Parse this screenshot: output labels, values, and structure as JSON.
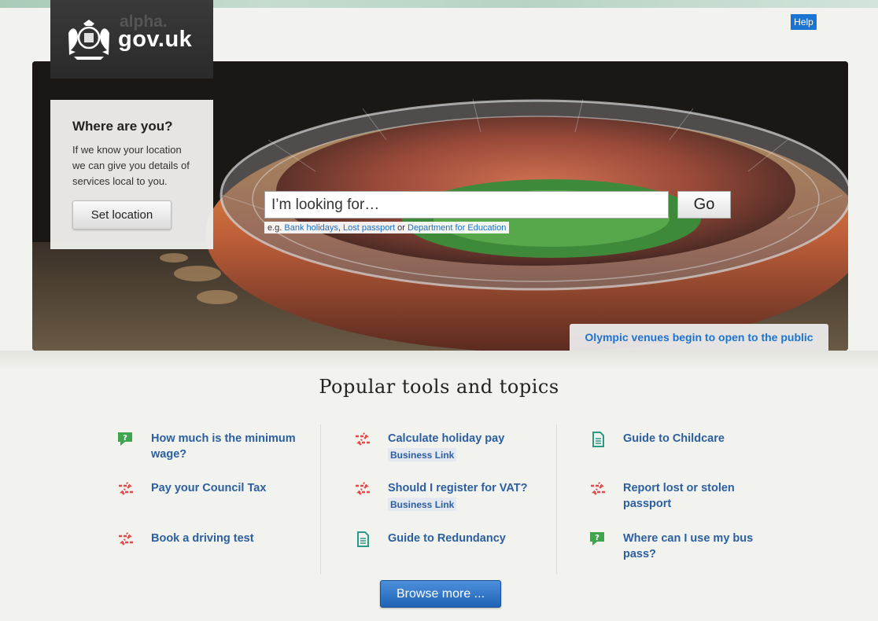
{
  "site": {
    "logo_alpha": "alpha.",
    "logo_gov": "gov.uk",
    "help_label": "Help"
  },
  "location": {
    "title": "Where are you?",
    "text": "If we know your location we can give you details of services local to you.",
    "button_label": "Set location"
  },
  "search": {
    "placeholder": "I’m looking for…",
    "go_label": "Go",
    "examples_prefix": "e.g.",
    "example_1": "Bank holidays",
    "sep_comma": ",",
    "example_2": "Lost passport",
    "sep_or": "or",
    "example_3": "Department for Education"
  },
  "hero": {
    "caption": "Olympic venues begin to open to the public"
  },
  "popular": {
    "title": "Popular tools and topics",
    "items": [
      {
        "label": "How much is the minimum wage?",
        "icon": "speech-bubble-icon"
      },
      {
        "label": "Pay your Council Tax",
        "icon": "arrows-icon"
      },
      {
        "label": "Book a driving test",
        "icon": "arrows-icon"
      },
      {
        "label": "Calculate holiday pay",
        "tag": "Business Link",
        "icon": "arrows-icon"
      },
      {
        "label": "Should I register for VAT?",
        "tag": "Business Link",
        "icon": "arrows-icon"
      },
      {
        "label": "Guide to Redundancy",
        "icon": "document-icon"
      },
      {
        "label": "Guide to Childcare",
        "icon": "document-icon"
      },
      {
        "label": "Report lost or stolen passport",
        "icon": "arrows-icon"
      },
      {
        "label": "Where can I use my bus pass?",
        "icon": "speech-bubble-icon"
      }
    ],
    "browse_label": "Browse more ..."
  },
  "colors": {
    "link": "#2b5fa0",
    "accent_blue": "#1c74d2",
    "icon_red": "#e5484a",
    "icon_green": "#3fa44d",
    "icon_teal": "#2a9a86"
  }
}
